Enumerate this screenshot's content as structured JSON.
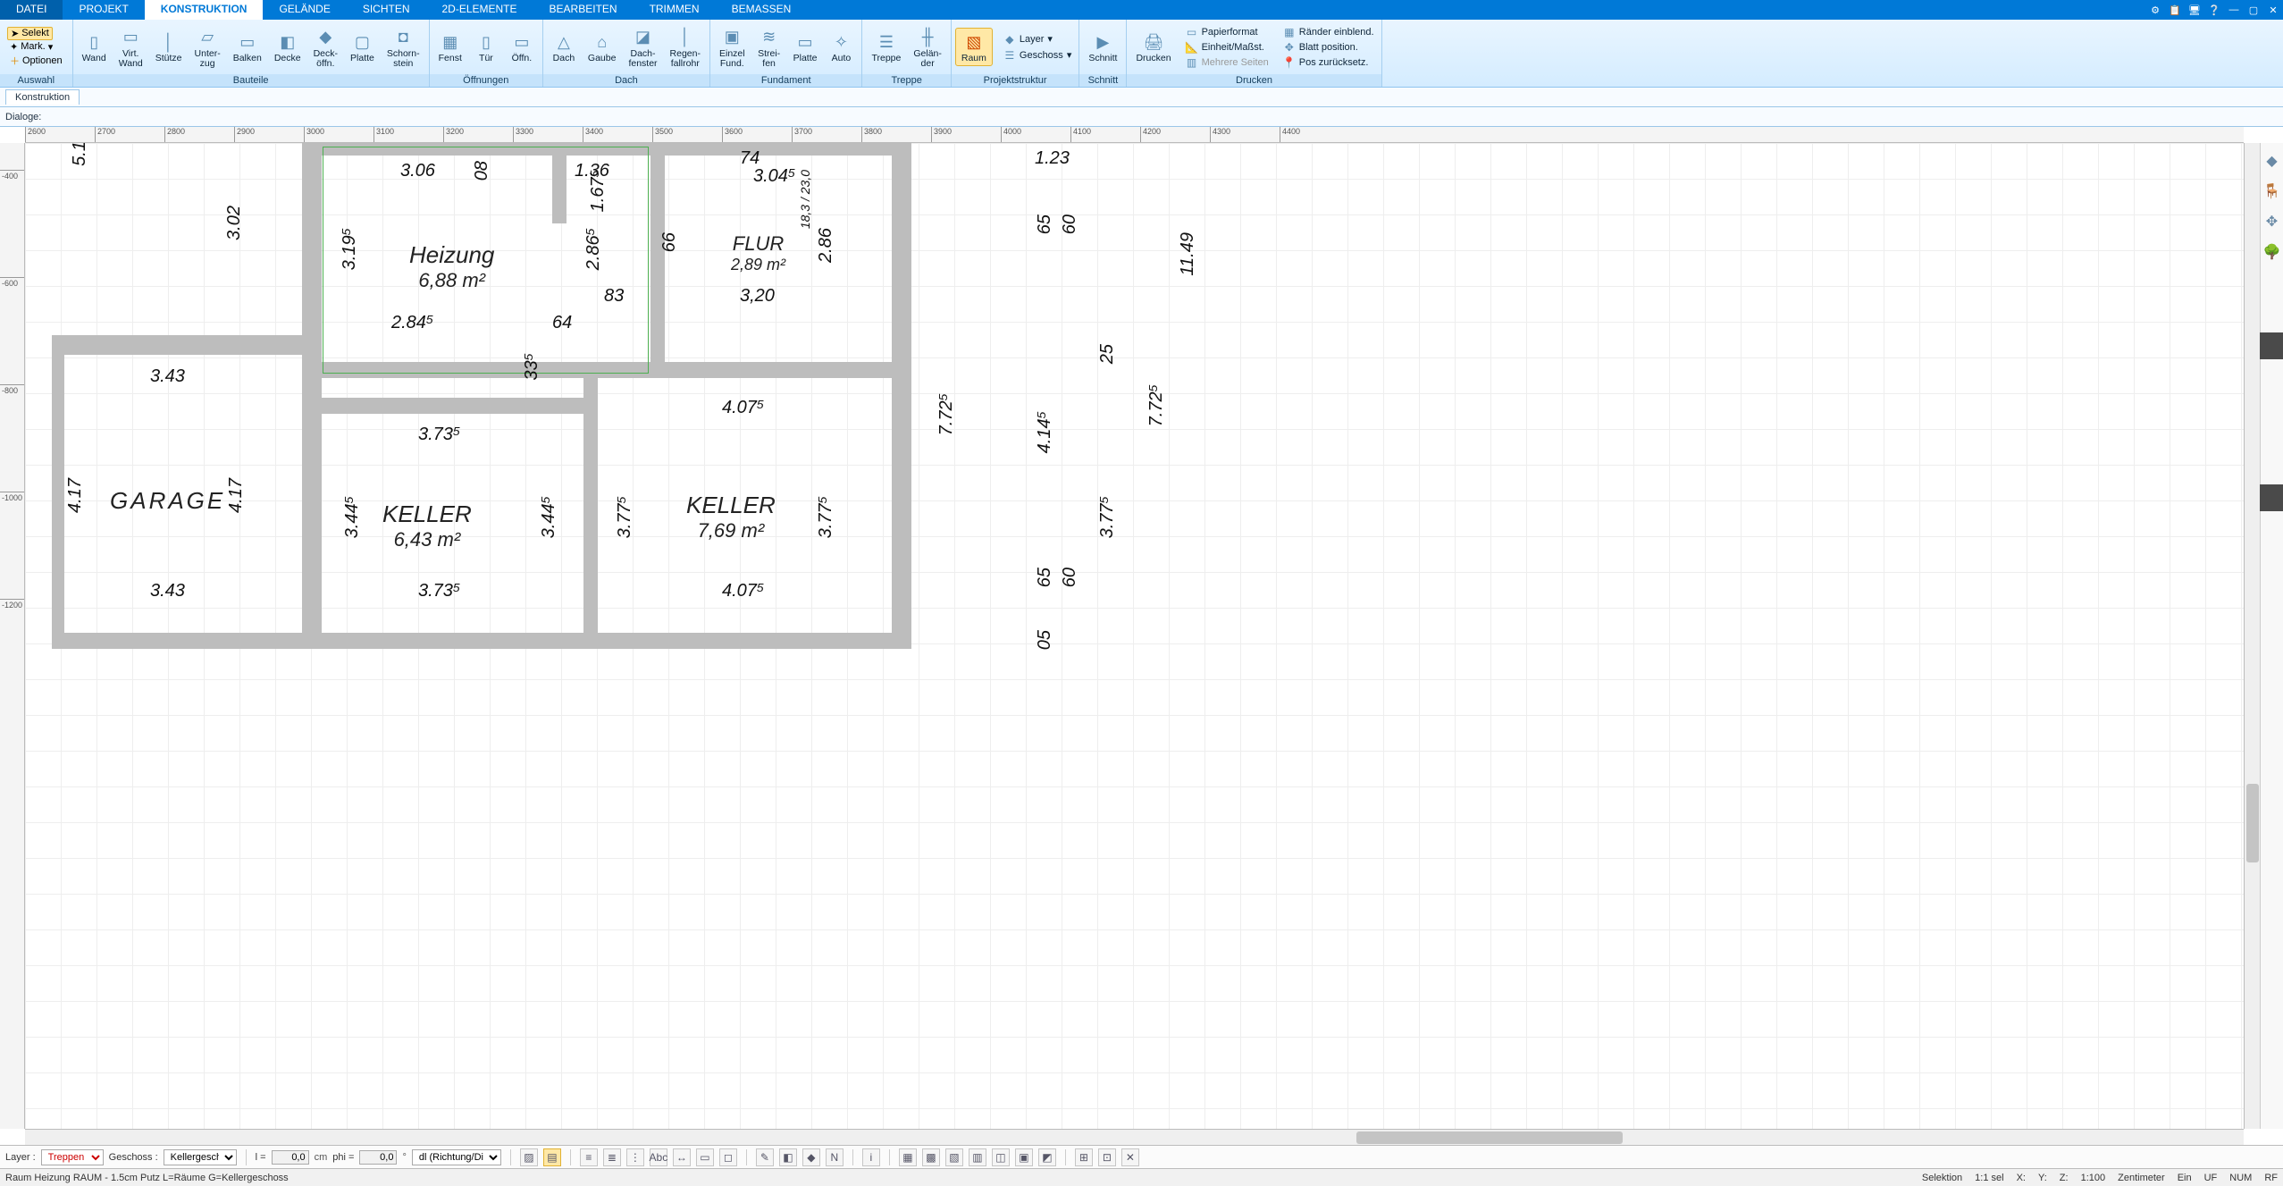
{
  "menuTabs": {
    "datei": "DATEI",
    "items": [
      "PROJEKT",
      "KONSTRUKTION",
      "GELÄNDE",
      "SICHTEN",
      "2D-ELEMENTE",
      "BEARBEITEN",
      "TRIMMEN",
      "BEMASSEN"
    ],
    "active": "KONSTRUKTION"
  },
  "titlebarIcons": [
    "⚙",
    "📋",
    "🖥",
    "❔",
    "—",
    "▢",
    "✕"
  ],
  "ribbon": {
    "auswahl": {
      "label": "Auswahl",
      "selekt": "Selekt",
      "mark": "Mark.",
      "optionen": "Optionen"
    },
    "bauteile": {
      "label": "Bauteile",
      "items": [
        {
          "t": "Wand",
          "i": "▯"
        },
        {
          "t": "Virt.\nWand",
          "i": "▭"
        },
        {
          "t": "Stütze",
          "i": "│"
        },
        {
          "t": "Unter-\nzug",
          "i": "▱"
        },
        {
          "t": "Balken",
          "i": "▭"
        },
        {
          "t": "Decke",
          "i": "◧"
        },
        {
          "t": "Deck-\nöffn.",
          "i": "◆"
        },
        {
          "t": "Platte",
          "i": "▢"
        },
        {
          "t": "Schorn-\nstein",
          "i": "◘"
        }
      ]
    },
    "oeffnungen": {
      "label": "Öffnungen",
      "items": [
        {
          "t": "Fenst",
          "i": "▦"
        },
        {
          "t": "Tür",
          "i": "▯"
        },
        {
          "t": "Öffn.",
          "i": "▭"
        }
      ]
    },
    "dach": {
      "label": "Dach",
      "items": [
        {
          "t": "Dach",
          "i": "△"
        },
        {
          "t": "Gaube",
          "i": "⌂"
        },
        {
          "t": "Dach-\nfenster",
          "i": "◪"
        },
        {
          "t": "Regen-\nfallrohr",
          "i": "│"
        }
      ]
    },
    "fundament": {
      "label": "Fundament",
      "items": [
        {
          "t": "Einzel\nFund.",
          "i": "▣"
        },
        {
          "t": "Strei-\nfen",
          "i": "≋"
        },
        {
          "t": "Platte",
          "i": "▭"
        },
        {
          "t": "Auto",
          "i": "✧"
        }
      ]
    },
    "treppe": {
      "label": "Treppe",
      "items": [
        {
          "t": "Treppe",
          "i": "☰"
        },
        {
          "t": "Gelän-\nder",
          "i": "╫"
        }
      ]
    },
    "projektstruktur": {
      "label": "Projektstruktur",
      "raum": "Raum",
      "layer": "Layer",
      "geschoss": "Geschoss"
    },
    "schnitt": {
      "label": "Schnitt",
      "schnitt": "Schnitt"
    },
    "drucken": {
      "label": "Drucken",
      "drucken": "Drucken",
      "right": [
        "Papierformat",
        "Einheit/Maßst.",
        "Mehrere Seiten",
        "Ränder einblend.",
        "Blatt position.",
        "Pos zurücksetz."
      ]
    }
  },
  "subbar1": "Konstruktion",
  "subbar2": "Dialoge:",
  "rulerH": [
    2600,
    2700,
    2800,
    2900,
    3000,
    3100,
    3200,
    3300,
    3400,
    3500,
    3600,
    3700,
    3800,
    3900,
    4000,
    4100,
    4200,
    4300,
    4400
  ],
  "rulerV": [
    -400,
    -600,
    -800,
    -1000,
    -1200
  ],
  "rooms": {
    "heizung": {
      "name": "Heizung",
      "area": "6,88 m²"
    },
    "flur": {
      "name": "FLUR",
      "area": "2,89 m²"
    },
    "keller1": {
      "name": "KELLER",
      "area": "6,43 m²"
    },
    "keller2": {
      "name": "KELLER",
      "area": "7,69 m²"
    },
    "garage": {
      "name": "GARAGE"
    }
  },
  "dims": {
    "d306": "3.06",
    "d136": "1.36",
    "d74": "74",
    "d3045": "3.04⁵",
    "d123": "1.23",
    "d302": "3.02",
    "d3195": "3.19⁵",
    "d08": "08",
    "d1675": "1.67⁵",
    "d2865": "2.86⁵",
    "d66": "66",
    "d183": "18,3 / 23,0",
    "d286": "2.86",
    "d65a": "65",
    "d60a": "60",
    "d1149": "11.49",
    "d2845": "2.84⁵",
    "d64": "64",
    "d83": "83",
    "d320": "3,20",
    "d335": "33⁵",
    "d25": "25",
    "d343a": "3.43",
    "d3735a": "3.73⁵",
    "d4075a": "4.07⁵",
    "d7725": "7.72⁵",
    "d4145": "4.14⁵",
    "d7725b": "7.72⁵",
    "d417a": "4.17",
    "d417b": "4.17",
    "d3445a": "3.44⁵",
    "d3445b": "3.44⁵",
    "d3775a": "3.77⁵",
    "d3775b": "3.77⁵",
    "d3775c": "3.77⁵",
    "d343b": "3.43",
    "d3735b": "3.73⁵",
    "d4075b": "4.07⁵",
    "d65b": "65",
    "d60b": "60",
    "d05": "05",
    "d51": "5.1"
  },
  "bottom": {
    "layer_lbl": "Layer :",
    "layer_val": "Treppen",
    "geschoss_lbl": "Geschoss :",
    "geschoss_val": "Kellergesch",
    "l_lbl": "l =",
    "l_val": "0,0",
    "cm": "cm",
    "phi_lbl": "phi =",
    "phi_val": "0,0",
    "deg": "°",
    "dir_val": "dl (Richtung/Di"
  },
  "status": {
    "left": "Raum Heizung RAUM - 1.5cm Putz L=Räume G=Kellergeschoss",
    "selektion": "Selektion",
    "sel": "1:1 sel",
    "x": "X:",
    "y": "Y:",
    "z": "Z:",
    "scale": "1:100",
    "unit": "Zentimeter",
    "ein": "Ein",
    "uf": "UF",
    "num": "NUM",
    "rf": "RF"
  }
}
